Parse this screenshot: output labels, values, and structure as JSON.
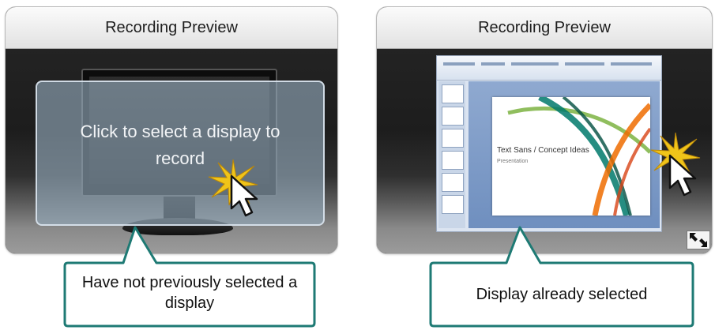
{
  "left_panel": {
    "header": "Recording Preview",
    "overlay_text": "Click to select a display to record"
  },
  "right_panel": {
    "header": "Recording Preview",
    "slide_title": "Text Sans / Concept Ideas",
    "slide_subtitle": "Presentation"
  },
  "callouts": {
    "left": "Have not previously selected a display",
    "right": "Display already selected"
  },
  "colors": {
    "callout_border": "#1e7a74",
    "burst": "#f0c419"
  }
}
